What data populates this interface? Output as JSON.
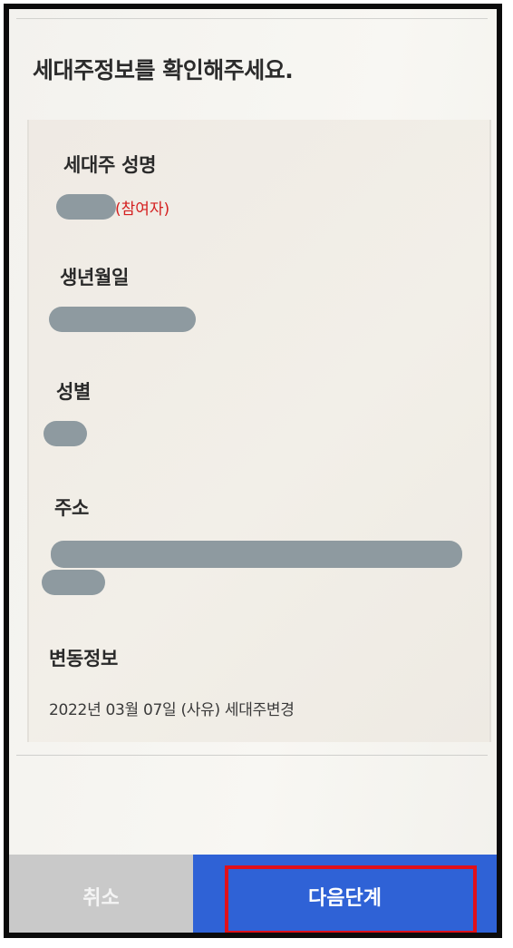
{
  "page": {
    "title": "세대주정보를 확인해주세요."
  },
  "household": {
    "head_name_label": "세대주 성명",
    "head_name_role": "(참여자)",
    "birth_label": "생년월일",
    "gender_label": "성별",
    "address_label": "주소",
    "change_label": "변동정보",
    "change_detail": "2022년 03월 07일 (사유) 세대주변경"
  },
  "actions": {
    "cancel_label": "취소",
    "next_label": "다음단계"
  },
  "colors": {
    "primary_button": "#2f62d6",
    "cancel_button": "#c9c9c9",
    "participant_tag": "#d42020",
    "highlight_outline": "#e0101a",
    "redaction": "#8e9aa0"
  }
}
